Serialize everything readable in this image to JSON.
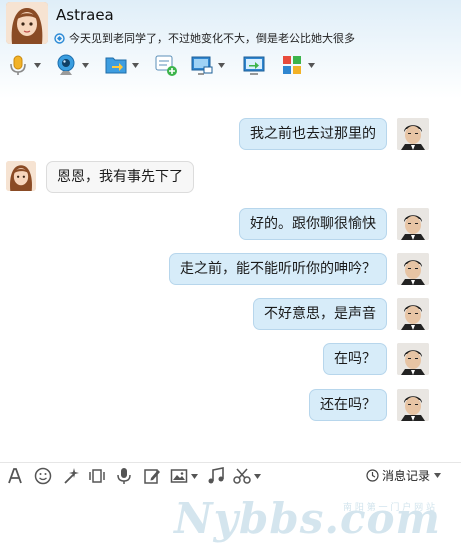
{
  "header": {
    "contact_name": "Astraea",
    "status_text": "今天见到老同学了，不过她变化不大，倒是老公比她大很多"
  },
  "toolbar": {
    "items": [
      {
        "name": "voice-call",
        "icon": "microphone-icon"
      },
      {
        "name": "video-call",
        "icon": "webcam-icon"
      },
      {
        "name": "send-file",
        "icon": "folder-transfer-icon"
      },
      {
        "name": "create-discussion",
        "icon": "chat-add-icon"
      },
      {
        "name": "remote-assist",
        "icon": "screen-share-icon"
      },
      {
        "name": "share-screen",
        "icon": "screen-arrow-icon"
      },
      {
        "name": "apps",
        "icon": "apps-grid-icon"
      }
    ]
  },
  "messages": [
    {
      "from": "me",
      "text": "我之前也去过那里的"
    },
    {
      "from": "them",
      "text": "恩恩，我有事先下了"
    },
    {
      "from": "me",
      "text": "好的。跟你聊很愉快"
    },
    {
      "from": "me",
      "text": "走之前，能不能听听你的呻吟？"
    },
    {
      "from": "me",
      "text": "不好意思，是声音"
    },
    {
      "from": "me",
      "text": "在吗？"
    },
    {
      "from": "me",
      "text": "还在吗？"
    }
  ],
  "input_toolbar": {
    "items": [
      "font-icon",
      "emoji-icon",
      "magic-wand-icon",
      "shake-icon",
      "voice-message-icon",
      "edit-icon",
      "image-icon",
      "music-icon",
      "scissors-icon"
    ],
    "history_label": "消息记录"
  },
  "watermark": {
    "brand": "Nybbs.com",
    "tagline": "南 阳 第 一 门 户 网 站"
  },
  "colors": {
    "bubble_me": "#d7ecf9",
    "bubble_them": "#f7f7f7"
  }
}
